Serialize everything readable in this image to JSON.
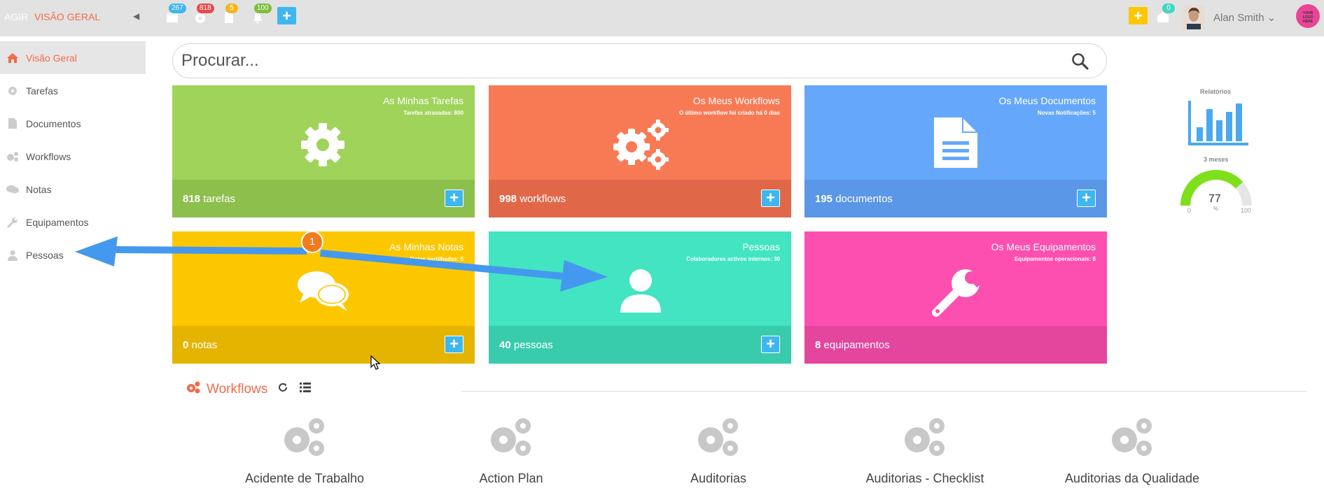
{
  "topbar": {
    "brand": "AGIR",
    "title": "VISÃO GERAL",
    "badges": {
      "calendar": "267",
      "settings": "818",
      "documents": "5",
      "notifications": "100",
      "messages": "0"
    },
    "user_name": "Alan Smith",
    "logo_text": "YOUR LOGO HERE"
  },
  "sidebar": {
    "items": [
      {
        "label": "Visão Geral",
        "icon": "home-icon"
      },
      {
        "label": "Tarefas",
        "icon": "gear-icon"
      },
      {
        "label": "Documentos",
        "icon": "document-icon"
      },
      {
        "label": "Workflows",
        "icon": "gears-icon"
      },
      {
        "label": "Notas",
        "icon": "chat-icon"
      },
      {
        "label": "Equipamentos",
        "icon": "wrench-icon"
      },
      {
        "label": "Pessoas",
        "icon": "user-icon"
      }
    ]
  },
  "search": {
    "placeholder": "Procurar..."
  },
  "tiles": [
    {
      "title": "As Minhas Tarefas",
      "subtitle": "Tarefas atrasadas: 800",
      "count": "818",
      "unit": "tarefas",
      "color": "#9fd35a",
      "foot_color": "#8cbf4c"
    },
    {
      "title": "Os Meus Workflows",
      "subtitle": "O último workflow foi criado há 0 dias",
      "count": "998",
      "unit": "workflows",
      "color": "#f87a55",
      "foot_color": "#e06849"
    },
    {
      "title": "Os Meus Documentos",
      "subtitle": "Novas Notificações: 5",
      "count": "195",
      "unit": "documentos",
      "color": "#65a8fb",
      "foot_color": "#5a97e6"
    },
    {
      "title": "As Minhas Notas",
      "subtitle": "Notas partilhadas: 0",
      "count": "0",
      "unit": "notas",
      "color": "#fdc700",
      "foot_color": "#e5b400"
    },
    {
      "title": "Pessoas",
      "subtitle": "Colaboradores activos internos: 30",
      "count": "40",
      "unit": "pessoas",
      "color": "#42e4c2",
      "foot_color": "#38ccad"
    },
    {
      "title": "Os Meus Equipamentos",
      "subtitle": "Equipamentos operacionais: 8",
      "count": "8",
      "unit": "equipamentos",
      "color": "#fd4faf",
      "foot_color": "#e4459d"
    }
  ],
  "annotation": {
    "step": "1"
  },
  "reports": {
    "label": "Relatórios",
    "period": "3 meses",
    "gauge": {
      "value": "77",
      "min": "0",
      "max": "100",
      "unit": "%"
    }
  },
  "workflows": {
    "title": "Workflows",
    "items": [
      "Acidente de Trabalho",
      "Action Plan",
      "Auditorias",
      "Auditorias - Checklist",
      "Auditorias da Qualidade"
    ]
  },
  "colors": {
    "accent": "#f26b4a",
    "add_button": "#3eb7ee",
    "arrow": "#4499ee",
    "step_badge": "#f47a1f"
  }
}
